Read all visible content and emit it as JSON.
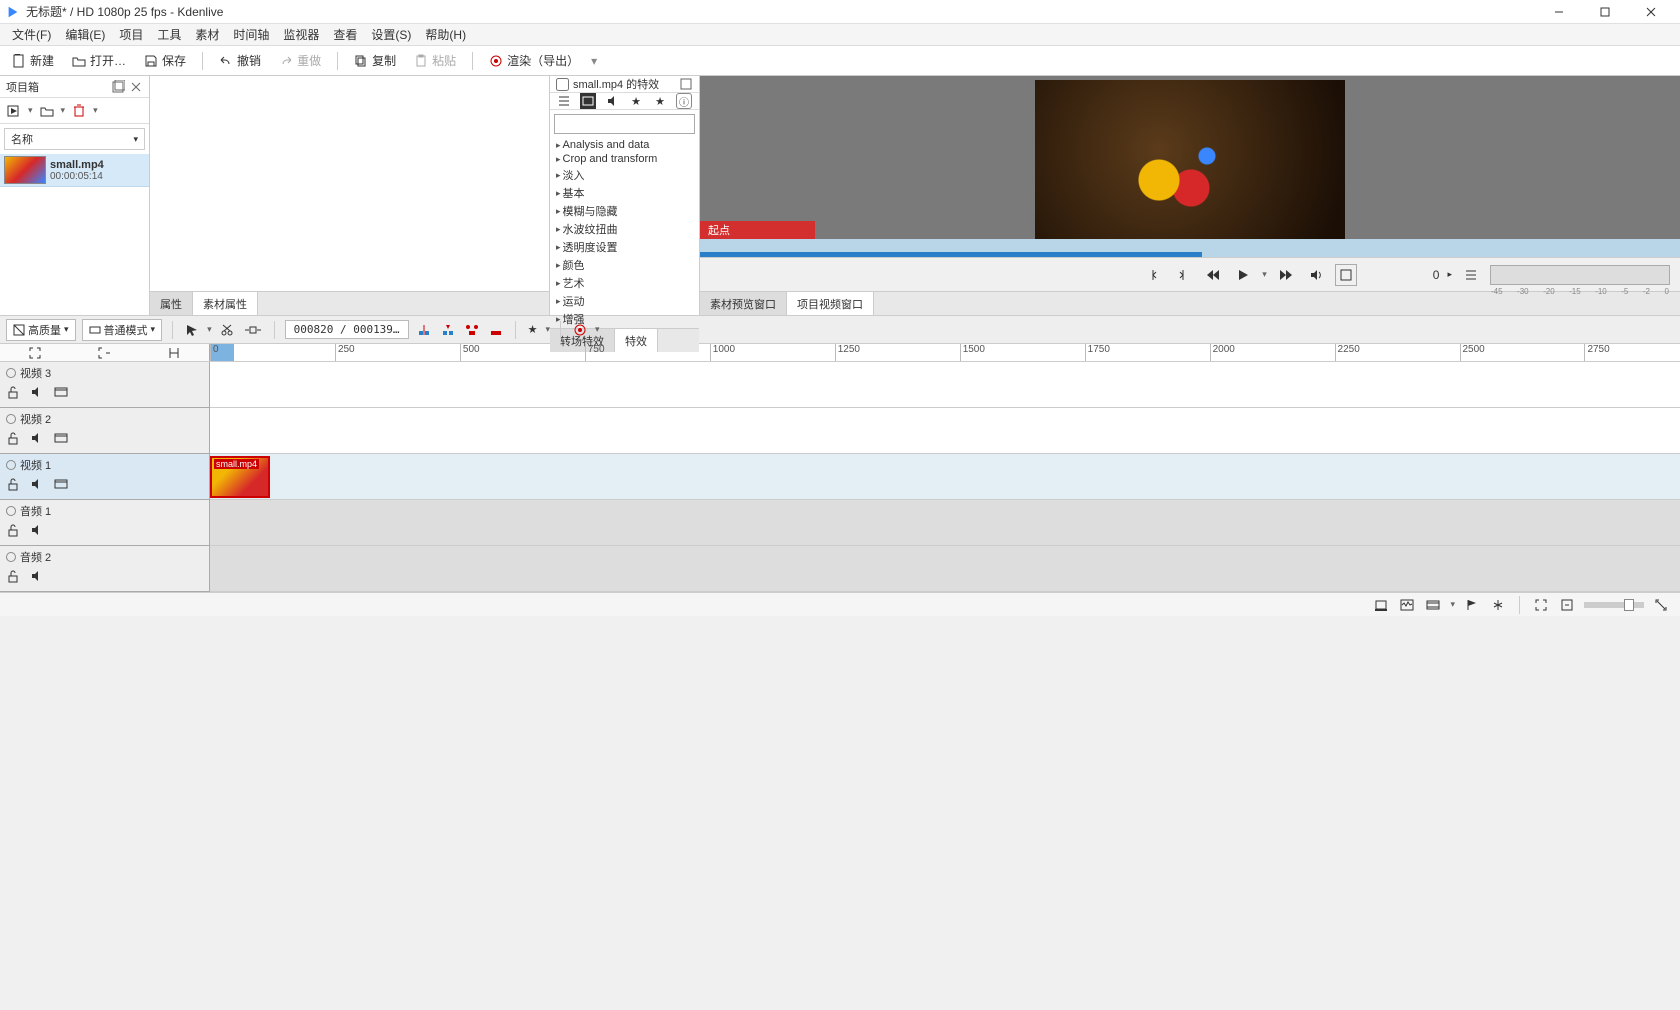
{
  "title": "无标题* / HD 1080p 25 fps - Kdenlive",
  "menu": [
    "文件(F)",
    "编辑(E)",
    "项目",
    "工具",
    "素材",
    "时间轴",
    "监视器",
    "查看",
    "设置(S)",
    "帮助(H)"
  ],
  "toolbar": {
    "new": "新建",
    "open": "打开…",
    "save": "保存",
    "undo": "撤销",
    "redo": "重做",
    "copy": "复制",
    "paste": "粘贴",
    "render": "渲染（导出）"
  },
  "bin": {
    "title": "项目箱",
    "filter": "名称",
    "items": [
      {
        "name": "small.mp4",
        "dur": "00:00:05:14"
      }
    ]
  },
  "effects": {
    "header": "small.mp4 的特效",
    "cats": [
      "Analysis and data",
      "Crop and transform",
      "淡入",
      "基本",
      "模糊与隐藏",
      "水波纹扭曲",
      "透明度设置",
      "颜色",
      "艺术",
      "运动",
      "增强"
    ]
  },
  "propTabs": {
    "attr": "属性",
    "clipAttr": "素材属性"
  },
  "effTabs": {
    "trans": "转场特效",
    "eff": "特效"
  },
  "monTabs": {
    "clip": "素材预览窗口",
    "proj": "项目视频窗口"
  },
  "monitor": {
    "start": "起点",
    "pos": "0",
    "meterTicks": [
      "-45",
      "-30",
      "-20",
      "-15",
      "-10",
      "-5",
      "-2",
      "0"
    ]
  },
  "tlTools": {
    "quality": "高质量",
    "mode": "普通模式",
    "frame": "000820 / 000139…"
  },
  "ruler": [
    "0",
    "250",
    "500",
    "750",
    "1000",
    "1250",
    "1500",
    "1750",
    "2000",
    "2250",
    "2500",
    "2750"
  ],
  "tracks": [
    {
      "name": "视频 3",
      "type": "v"
    },
    {
      "name": "视频 2",
      "type": "v"
    },
    {
      "name": "视频 1",
      "type": "v",
      "active": true,
      "clip": "small.mp4"
    },
    {
      "name": "音频 1",
      "type": "a"
    },
    {
      "name": "音频 2",
      "type": "a"
    }
  ]
}
